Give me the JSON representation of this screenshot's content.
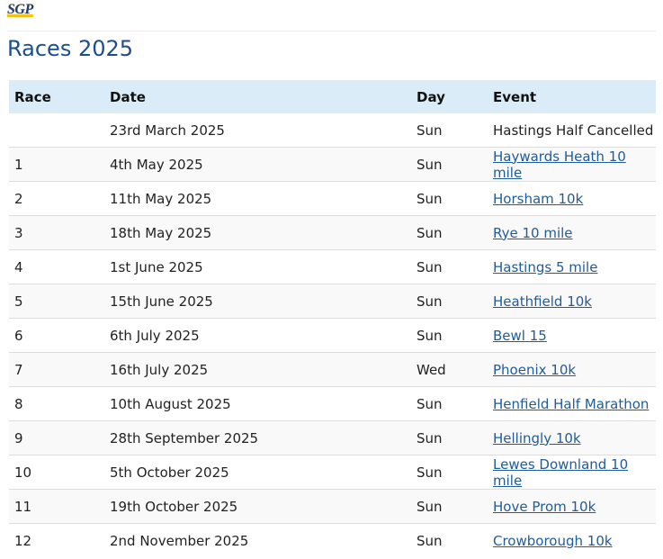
{
  "logo": {
    "text": "SGP",
    "colors": {
      "primary": "#1b3f7a",
      "accent": "#f2c21b"
    }
  },
  "page": {
    "title": "Races 2025"
  },
  "table": {
    "headers": [
      "Race",
      "Date",
      "Day",
      "Event"
    ],
    "rows": [
      {
        "race": "",
        "date": "23rd March 2025",
        "day": "Sun",
        "event": "Hastings Half Cancelled",
        "link": false
      },
      {
        "race": "1",
        "date": "4th May 2025",
        "day": "Sun",
        "event": "Haywards Heath 10 mile",
        "link": true
      },
      {
        "race": "2",
        "date": "11th May 2025",
        "day": "Sun",
        "event": "Horsham 10k",
        "link": true
      },
      {
        "race": "3",
        "date": "18th May 2025",
        "day": "Sun",
        "event": "Rye 10 mile",
        "link": true
      },
      {
        "race": "4",
        "date": "1st June 2025",
        "day": "Sun",
        "event": "Hastings 5 mile",
        "link": true
      },
      {
        "race": "5",
        "date": "15th June 2025",
        "day": "Sun",
        "event": "Heathfield 10k",
        "link": true
      },
      {
        "race": "6",
        "date": "6th July 2025",
        "day": "Sun",
        "event": "Bewl 15",
        "link": true
      },
      {
        "race": "7",
        "date": "16th July 2025",
        "day": "Wed",
        "event": "Phoenix 10k",
        "link": true
      },
      {
        "race": "8",
        "date": "10th August 2025",
        "day": "Sun",
        "event": "Henfield Half Marathon",
        "link": true
      },
      {
        "race": "9",
        "date": "28th September 2025",
        "day": "Sun",
        "event": "Hellingly 10k",
        "link": true
      },
      {
        "race": "10",
        "date": "5th October 2025",
        "day": "Sun",
        "event": "Lewes Downland 10 mile",
        "link": true
      },
      {
        "race": "11",
        "date": "19th October 2025",
        "day": "Sun",
        "event": "Hove Prom 10k",
        "link": true
      },
      {
        "race": "12",
        "date": "2nd November 2025",
        "day": "Sun",
        "event": "Crowborough 10k",
        "link": true
      }
    ]
  },
  "colors": {
    "title": "#1d4e89",
    "header_bg": "#d9ecf7",
    "link": "#1f5c99",
    "row_stripe": "#f9f9f9"
  }
}
